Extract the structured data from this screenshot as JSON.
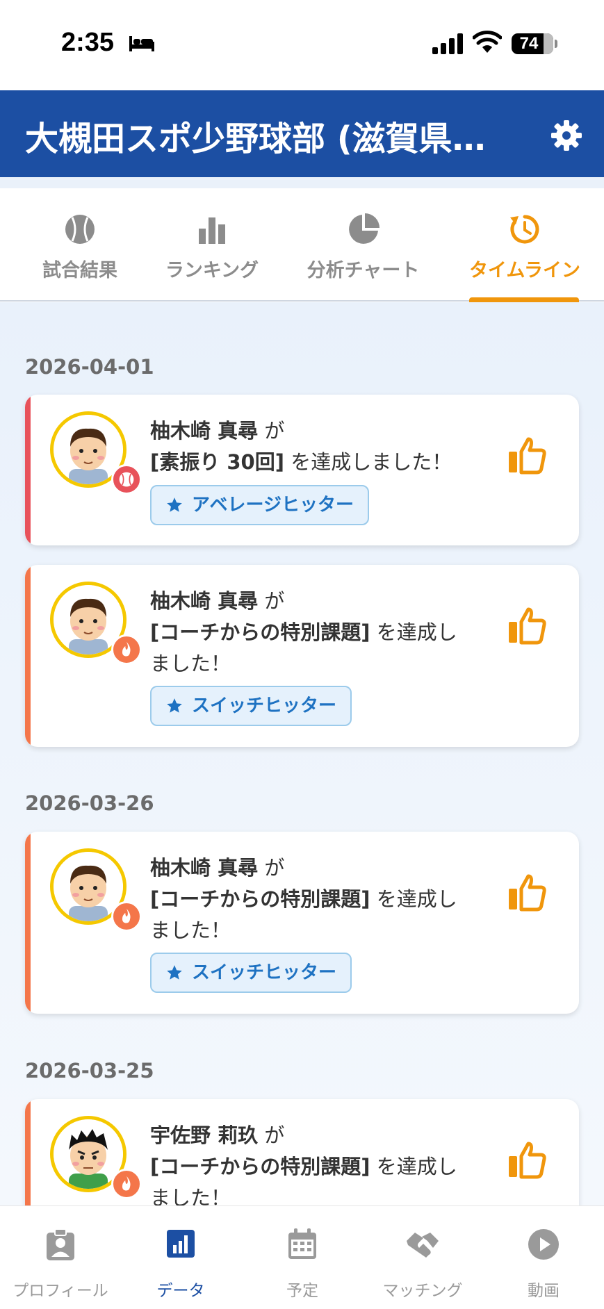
{
  "status_bar": {
    "time": "2:35",
    "battery": "74"
  },
  "header": {
    "title": "大槻田スポ少野球部 (滋賀県…"
  },
  "tabs": [
    {
      "label": "試合結果",
      "icon": "baseball-icon"
    },
    {
      "label": "ランキング",
      "icon": "bar-chart-icon"
    },
    {
      "label": "分析チャート",
      "icon": "pie-chart-icon"
    },
    {
      "label": "タイムライン",
      "icon": "history-icon",
      "active": true
    }
  ],
  "timeline": [
    {
      "date": "2026-04-01",
      "entries": [
        {
          "name": "柚木崎 真尋",
          "particle": "が",
          "task": "[素振り 30回]",
          "suffix": "を達成しました！",
          "badge": "アベレージヒッター",
          "stripe_color": "#e8525a",
          "badge_icon": "baseball-icon"
        },
        {
          "name": "柚木崎 真尋",
          "particle": "が",
          "task": "[コーチからの特別課題]",
          "suffix": "を達成しました！",
          "badge": "スイッチヒッター",
          "stripe_color": "#f4764a",
          "badge_icon": "flame-icon"
        }
      ]
    },
    {
      "date": "2026-03-26",
      "entries": [
        {
          "name": "柚木崎 真尋",
          "particle": "が",
          "task": "[コーチからの特別課題]",
          "suffix": "を達成しました！",
          "badge": "スイッチヒッター",
          "stripe_color": "#f4764a",
          "badge_icon": "flame-icon"
        }
      ]
    },
    {
      "date": "2026-03-25",
      "entries": [
        {
          "name": "宇佐野 莉玖",
          "particle": "が",
          "task": "[コーチからの特別課題]",
          "suffix": "を達成しました！",
          "badge": "",
          "stripe_color": "#f4764a",
          "badge_icon": "flame-icon"
        }
      ]
    }
  ],
  "bottom_nav": [
    {
      "label": "プロフィール",
      "icon": "profile-badge-icon"
    },
    {
      "label": "データ",
      "icon": "data-chart-icon",
      "active": true
    },
    {
      "label": "予定",
      "icon": "calendar-icon"
    },
    {
      "label": "マッチング",
      "icon": "handshake-icon"
    },
    {
      "label": "動画",
      "icon": "play-icon"
    }
  ],
  "colors": {
    "header": "#1c4fa3",
    "accent": "#f0960c",
    "chip_text": "#1e72c2"
  }
}
